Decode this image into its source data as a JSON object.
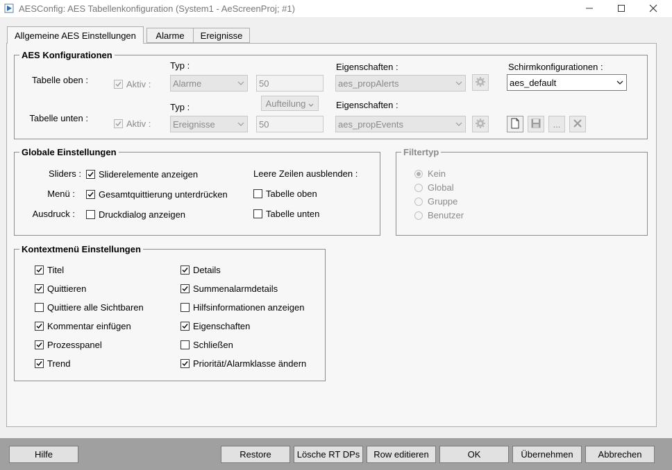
{
  "window": {
    "title": "AESConfig: AES Tabellenkonfiguration (System1 - AeScreenProj; #1)",
    "app_icon": "play-icon",
    "minimize_icon": "minimize-icon",
    "maximize_icon": "maximize-icon",
    "close_icon": "close-icon"
  },
  "tabs": [
    {
      "label": "Allgemeine AES Einstellungen",
      "active": true
    },
    {
      "label": "Alarme",
      "active": false
    },
    {
      "label": "Ereignisse",
      "active": false
    }
  ],
  "aes_config": {
    "title": "AES Konfigurationen",
    "top": {
      "label": "Tabelle oben :",
      "aktiv_label": "Aktiv :",
      "aktiv_checked": true,
      "typ_label": "Typ :",
      "typ_value": "Alarme",
      "count_value": "50",
      "props_label": "Eigenschaften :",
      "props_value": "aes_propAlerts",
      "settings_icon": "gear-icon"
    },
    "bottom": {
      "label": "Tabelle unten :",
      "aktiv_label": "Aktiv :",
      "aktiv_checked": true,
      "typ_label": "Typ :",
      "typ_value": "Ereignisse",
      "count_value": "50",
      "props_label": "Eigenschaften :",
      "props_value": "aes_propEvents",
      "settings_icon": "gear-icon"
    },
    "split_button_label": "Aufteilung",
    "screen_config_label": "Schirmkonfigurationen :",
    "screen_config_value": "aes_default",
    "file_buttons": {
      "new_icon": "new-file-icon",
      "save_icon": "save-icon",
      "more_label": "...",
      "delete_icon": "delete-icon"
    }
  },
  "global": {
    "title": "Globale Einstellungen",
    "sliders_label": "Sliders :",
    "sliders_cb_label": "Sliderelemente anzeigen",
    "sliders_checked": true,
    "menu_label": "Menü :",
    "menu_cb_label": "Gesamtquittierung unterdrücken",
    "menu_checked": true,
    "print_label": "Ausdruck :",
    "print_cb_label": "Druckdialog anzeigen",
    "print_checked": false,
    "empty_rows_label": "Leere Zeilen ausblenden :",
    "table_top_label": "Tabelle oben",
    "table_top_checked": false,
    "table_bottom_label": "Tabelle unten",
    "table_bottom_checked": false
  },
  "filter": {
    "title": "Filtertyp",
    "options": [
      {
        "label": "Kein",
        "selected": true
      },
      {
        "label": "Global",
        "selected": false
      },
      {
        "label": "Gruppe",
        "selected": false
      },
      {
        "label": "Benutzer",
        "selected": false
      }
    ]
  },
  "context": {
    "title": "Kontextmenü Einstellungen",
    "left": [
      {
        "label": "Titel",
        "checked": true
      },
      {
        "label": "Quittieren",
        "checked": true
      },
      {
        "label": "Quittiere alle Sichtbaren",
        "checked": false
      },
      {
        "label": "Kommentar einfügen",
        "checked": true
      },
      {
        "label": "Prozesspanel",
        "checked": true
      },
      {
        "label": "Trend",
        "checked": true
      }
    ],
    "right": [
      {
        "label": "Details",
        "checked": true
      },
      {
        "label": "Summenalarmdetails",
        "checked": true
      },
      {
        "label": "Hilfsinformationen anzeigen",
        "checked": false
      },
      {
        "label": "Eigenschaften",
        "checked": true
      },
      {
        "label": "Schließen",
        "checked": false
      },
      {
        "label": "Priorität/Alarmklasse ändern",
        "checked": true
      }
    ]
  },
  "buttons": {
    "help": "Hilfe",
    "restore": "Restore",
    "delete_rt": "Lösche RT DPs",
    "row_edit": "Row editieren",
    "ok": "OK",
    "apply": "Übernehmen",
    "cancel": "Abbrechen"
  }
}
